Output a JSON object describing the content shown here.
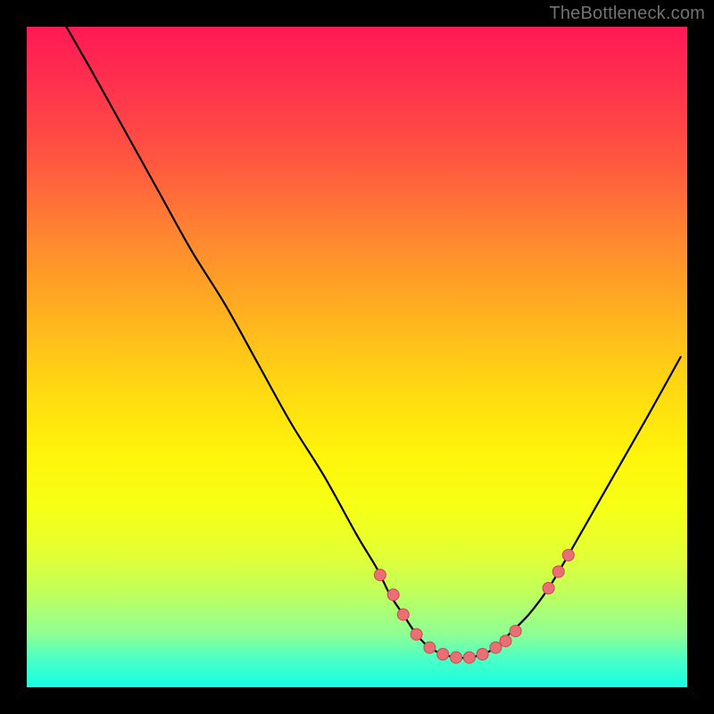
{
  "attribution": "TheBottleneck.com",
  "colors": {
    "curve_stroke": "#000000",
    "marker_fill": "#e96f74",
    "marker_stroke": "#c94a4f"
  },
  "chart_data": {
    "type": "line",
    "title": "",
    "xlabel": "",
    "ylabel": "",
    "xlim": [
      0,
      100
    ],
    "ylim": [
      0,
      100
    ],
    "grid": false,
    "legend": false,
    "series": [
      {
        "name": "bottleneck_curve",
        "x": [
          6,
          10,
          15,
          20,
          25,
          30,
          35,
          40,
          45,
          50,
          53,
          55,
          57,
          59,
          61,
          63,
          65,
          67,
          69,
          71,
          73,
          76,
          79,
          82,
          86,
          90,
          94,
          99
        ],
        "y": [
          100,
          93,
          84,
          75,
          66,
          58,
          49,
          40,
          32,
          23,
          18,
          14,
          11,
          8,
          6,
          5,
          4.5,
          4.5,
          5,
          6,
          8,
          11,
          15,
          20,
          27,
          34,
          41,
          50
        ]
      }
    ],
    "markers": {
      "name": "highlighted_points",
      "x": [
        53.5,
        55.5,
        57,
        59,
        61,
        63,
        65,
        67,
        69,
        71,
        72.5,
        74,
        79,
        80.5,
        82
      ],
      "y": [
        17,
        14,
        11,
        8,
        6,
        5,
        4.5,
        4.5,
        5,
        6,
        7,
        8.5,
        15,
        17.5,
        20
      ]
    }
  }
}
